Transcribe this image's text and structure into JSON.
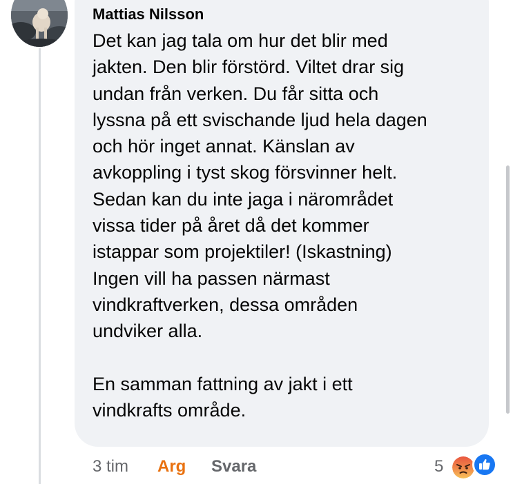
{
  "comment": {
    "author": "Mattias Nilsson",
    "avatar": {
      "icon": "profile-photo-dog-by-water"
    },
    "lines": [
      "Det kan jag tala om hur det blir med",
      "jakten. Den blir förstörd. Viltet drar sig",
      "undan från verken. Du får sitta och",
      "lyssna på ett svischande ljud hela dagen",
      "och hör inget annat. Känslan av",
      "avkoppling i tyst skog försvinner helt.",
      "Sedan kan du inte jaga i närområdet",
      "vissa tider på året då det kommer",
      "istappar som projektiler! (Iskastning)",
      "Ingen vill ha passen närmast",
      "vindkraftverken, dessa områden",
      "undviker alla."
    ],
    "lines_after_break": [
      "En samman fattning av jakt i ett",
      "vindkrafts område."
    ]
  },
  "actions": {
    "time": "3 tim",
    "reaction_label": "Arg",
    "reply_label": "Svara",
    "reaction_count": "5",
    "reaction_icons": [
      "angry-reaction-icon",
      "like-reaction-icon"
    ]
  },
  "colors": {
    "bubble": "#f0f2f5",
    "text": "#050505",
    "muted": "#65676b",
    "arg": "#e9710f",
    "like": "#1877f2"
  }
}
